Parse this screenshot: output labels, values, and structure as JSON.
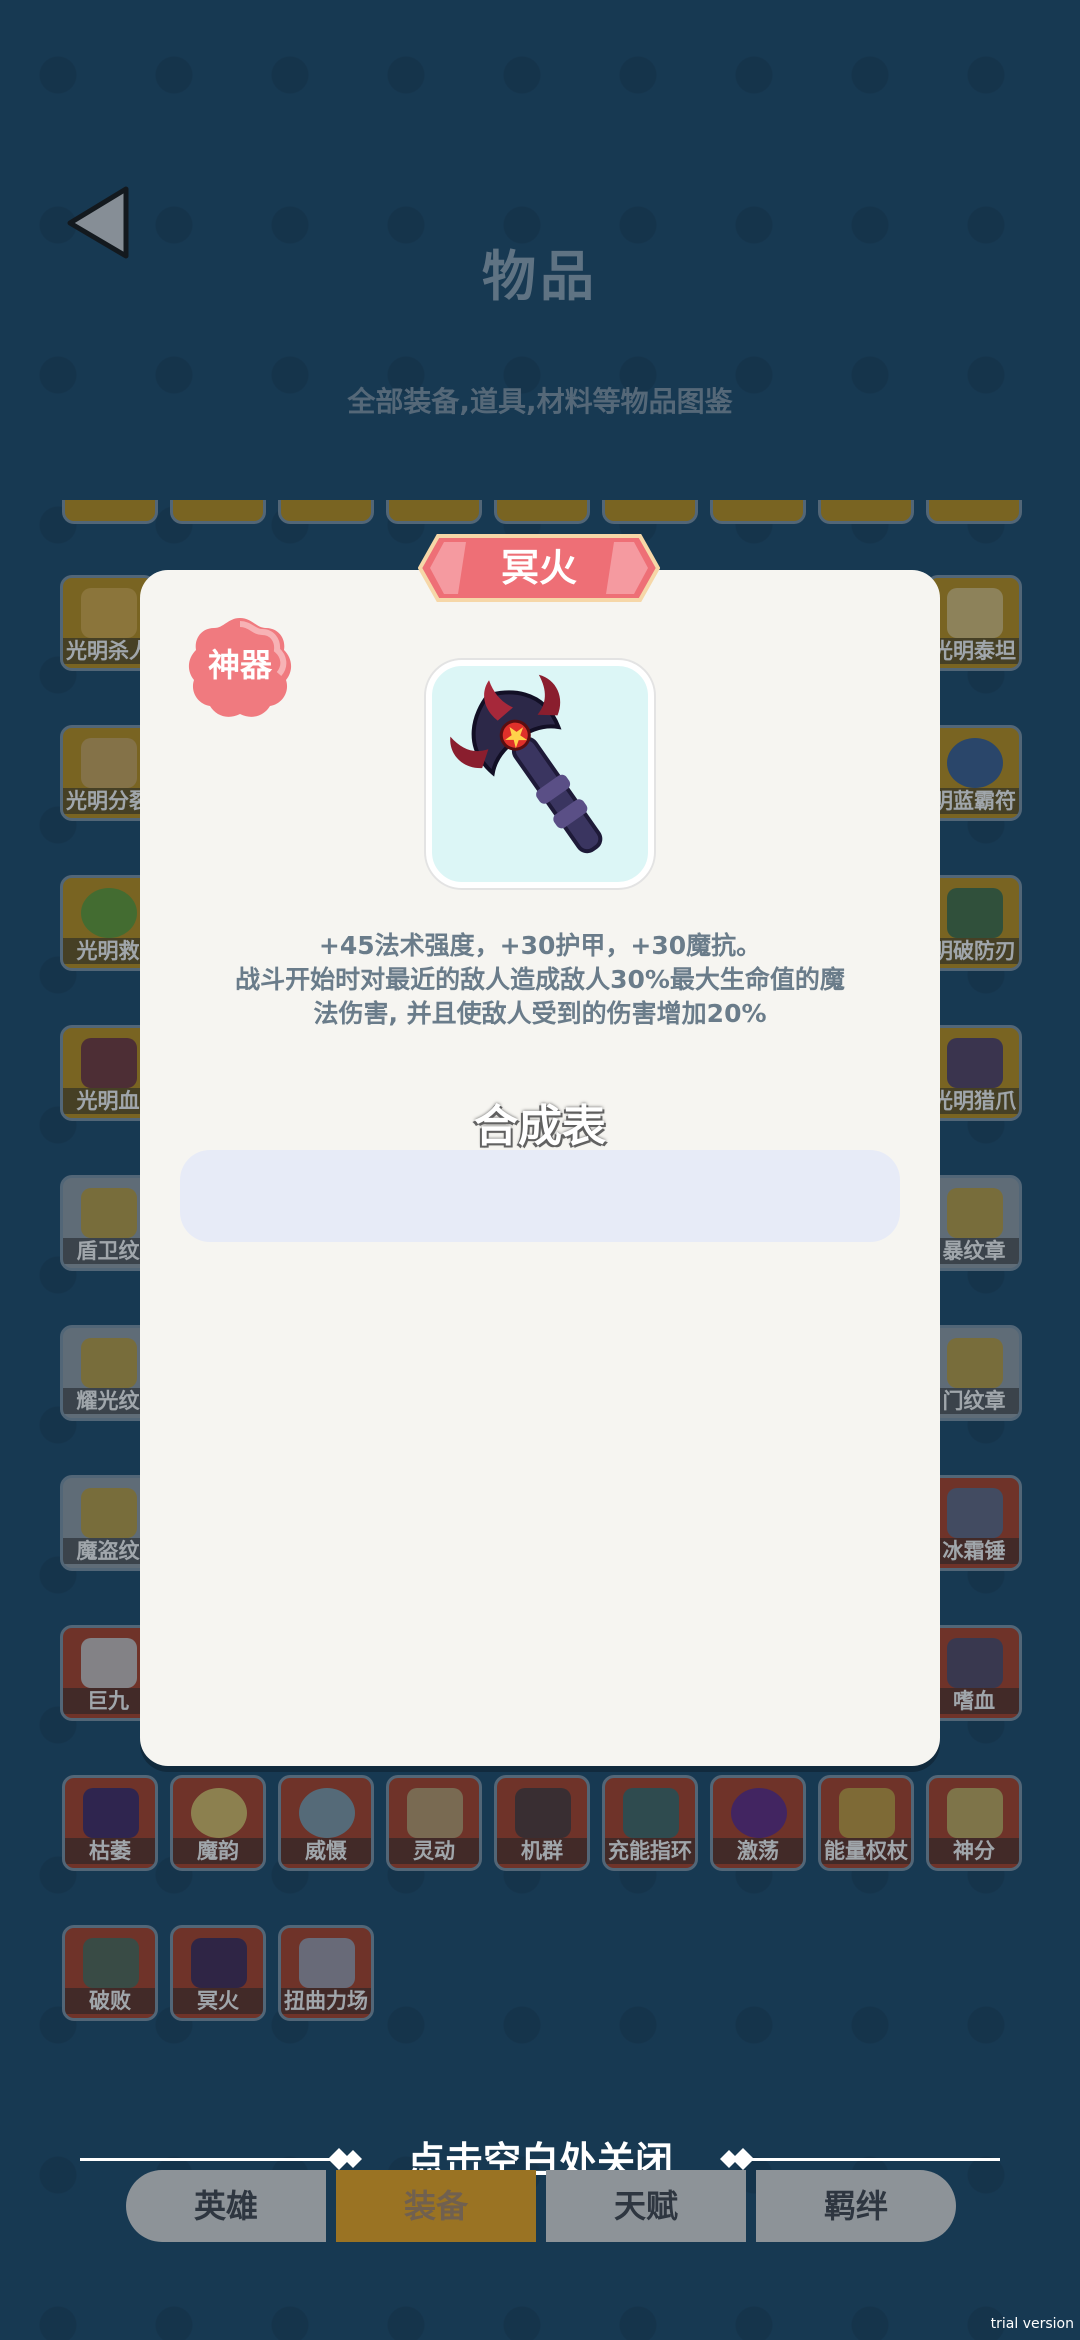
{
  "header": {
    "title": "物品",
    "subtitle": "全部装备,道具,材料等物品图鉴"
  },
  "grid": {
    "left_column": [
      "光明杀人",
      "光明分裂",
      "光明救",
      "光明血",
      "盾卫纹",
      "耀光纹",
      "魔盗纹",
      "巨九"
    ],
    "right_column": [
      "光明泰坦",
      "明蓝霸符",
      "明破防刃",
      "光明猎爪",
      "暴纹章",
      "门纹章",
      "冰霜锤",
      "嗜血"
    ],
    "row_9": [
      "枯萎",
      "魔韵",
      "威慑",
      "灵动",
      "机群",
      "充能指环",
      "激荡",
      "能量权杖",
      "神分"
    ],
    "row_10": [
      "破败",
      "冥火",
      "扭曲力场"
    ]
  },
  "dialog": {
    "name": "冥火",
    "rarity": "神器",
    "icon": "dark-flame-staff-icon",
    "description_lines": [
      "+45法术强度，+30护甲，+30魔抗。",
      "战斗开始时对最近的敌人造成敌人30%最大生命值的魔",
      "法伤害, 并且使敌人受到的伤害增加20%"
    ],
    "recipe_title": "合成表"
  },
  "close_hint": "点击空白处关闭",
  "tabs": [
    {
      "label": "英雄",
      "active": false
    },
    {
      "label": "装备",
      "active": true
    },
    {
      "label": "天赋",
      "active": false
    },
    {
      "label": "羁绊",
      "active": false
    }
  ],
  "watermark": "trial version",
  "colors": {
    "ribbon": "#ee6f76",
    "badge": "#f07a7f",
    "active_tab": "#9a7323"
  }
}
